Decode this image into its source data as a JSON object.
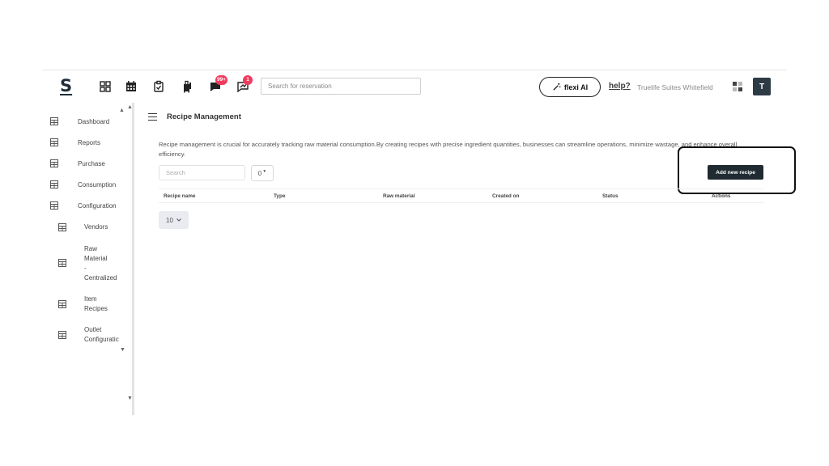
{
  "topbar": {
    "logo": "S",
    "icons": [
      "apps-grid-icon",
      "calendar-icon",
      "clipboard-check-icon",
      "luggage-icon",
      "chat-icon",
      "chart-message-icon"
    ],
    "chat_badge": "99+",
    "notification_badge": "1",
    "search_placeholder": "Search for reservation",
    "flexi_label": "flexi AI",
    "help_label": "help?",
    "property_name": "Truelife Suites Whitefield",
    "avatar_initial": "T"
  },
  "sidebar": {
    "items": [
      {
        "label": "Dashboard"
      },
      {
        "label": "Reports"
      },
      {
        "label": "Purchase"
      },
      {
        "label": "Consumption"
      },
      {
        "label": "Configuration"
      }
    ],
    "subitems": [
      {
        "lines": [
          "Vendors"
        ]
      },
      {
        "lines": [
          "Raw",
          "Material",
          "-",
          "Centralized"
        ]
      },
      {
        "lines": [
          "Item",
          "Recipes"
        ]
      },
      {
        "lines": [
          "Outlet",
          "Configuratic"
        ]
      }
    ]
  },
  "main": {
    "title": "Recipe Management",
    "description": "Recipe management is crucial for accurately tracking raw material consumption.By creating recipes with precise ingredient quantities, businesses can streamline operations, minimize wastage, and enhance overall efficiency.",
    "search_placeholder": "Search",
    "filter_label": "0",
    "add_button": "Add new recipe",
    "columns": [
      "Recipe name",
      "Type",
      "Raw material",
      "Created on",
      "Status",
      "Actions"
    ],
    "page_size": "10"
  },
  "colors": {
    "dark_button": "#1f2a31",
    "badge": "#ef3b5d",
    "avatar": "#2d3b45"
  }
}
